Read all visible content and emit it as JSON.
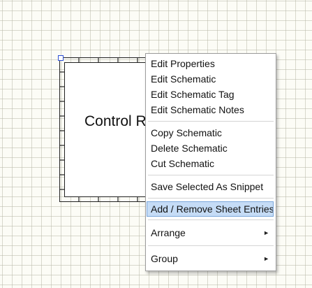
{
  "schematic": {
    "title": "Control R"
  },
  "context_menu": {
    "groups": [
      {
        "items": [
          {
            "label": "Edit Properties"
          },
          {
            "label": "Edit Schematic"
          },
          {
            "label": "Edit Schematic Tag"
          },
          {
            "label": "Edit Schematic Notes"
          }
        ]
      },
      {
        "items": [
          {
            "label": "Copy Schematic"
          },
          {
            "label": "Delete Schematic"
          },
          {
            "label": "Cut Schematic"
          }
        ]
      },
      {
        "items": [
          {
            "label": "Save Selected As Snippet"
          }
        ]
      },
      {
        "items": [
          {
            "label": "Add / Remove Sheet Entries",
            "highlighted": true
          }
        ]
      },
      {
        "items": [
          {
            "label": "Arrange",
            "submenu_arrow": "►"
          }
        ]
      },
      {
        "items": [
          {
            "label": "Group",
            "submenu_arrow": "►"
          }
        ]
      }
    ]
  },
  "colors": {
    "canvas_background": "#fcfcf6",
    "grid_line": "#b9b9aa",
    "menu_highlight": "#c5dcf6",
    "menu_highlight_border": "#7aa6da",
    "selection_handle": "#2c4fd6"
  },
  "icons": {
    "submenu": "right-triangle-arrow"
  }
}
